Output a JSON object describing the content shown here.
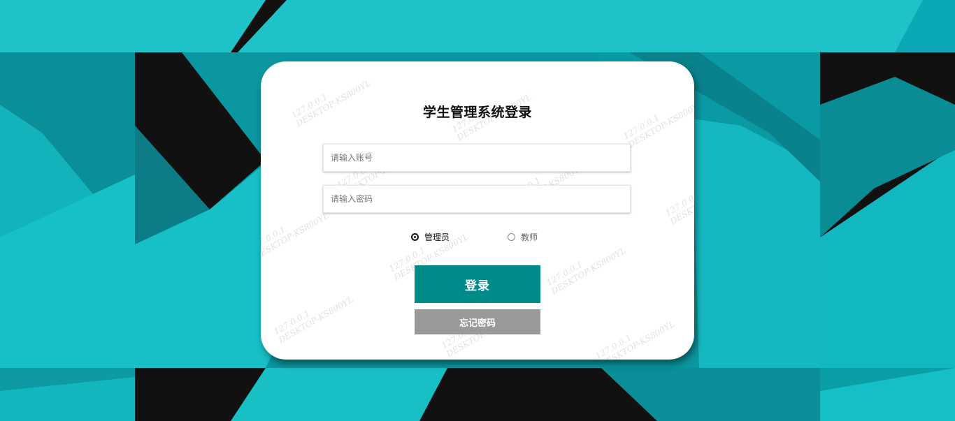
{
  "login": {
    "title": "学生管理系统登录",
    "account_placeholder": "请输入账号",
    "password_placeholder": "请输入密码",
    "roles": [
      {
        "label": "管理员",
        "selected": true
      },
      {
        "label": "教师",
        "selected": false
      }
    ],
    "login_label": "登录",
    "forgot_label": "忘记密码"
  },
  "watermark": {
    "ip": "127.0.0.1",
    "host": "DESKTOP-KS800YL"
  },
  "colors": {
    "background_teal": "#0fbcc4",
    "background_dark": "#111111",
    "login_button": "#008b8b",
    "forgot_button": "#999999",
    "card": "#ffffff"
  }
}
